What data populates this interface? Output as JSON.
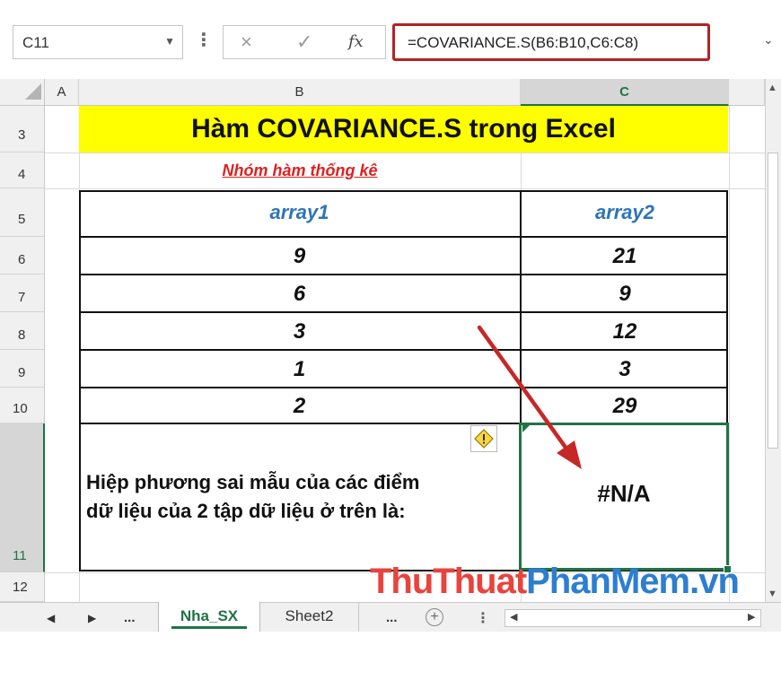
{
  "formula_bar": {
    "name_box": "C11",
    "cancel_icon": "×",
    "enter_icon": "✓",
    "fx_label": "fx",
    "formula": "=COVARIANCE.S(B6:B10,C6:C8)"
  },
  "columns": [
    {
      "label": "A"
    },
    {
      "label": "B"
    },
    {
      "label": "C",
      "selected": true
    }
  ],
  "rows": [
    "3",
    "4",
    "5",
    "6",
    "7",
    "8",
    "9",
    "10",
    "11",
    "12"
  ],
  "sheet": {
    "title": "Hàm COVARIANCE.S trong Excel",
    "subtitle": "Nhóm hàm thống kê",
    "header_array1": "array1",
    "header_array2": "array2",
    "data": [
      {
        "array1": "9",
        "array2": "21"
      },
      {
        "array1": "6",
        "array2": "9"
      },
      {
        "array1": "3",
        "array2": "12"
      },
      {
        "array1": "1",
        "array2": "3"
      },
      {
        "array1": "2",
        "array2": "29"
      }
    ],
    "description_line1": "Hiệp phương sai mẫu của các điểm",
    "description_line2": "dữ liệu của 2 tập dữ liệu ở trên là:",
    "result": "#N/A"
  },
  "watermark": {
    "part1": "ThuThuat",
    "part2": "PhanMem.vn"
  },
  "tabs": {
    "more_left": "...",
    "active_tab": "Nha_SX",
    "tab2": "Sheet2",
    "more_right": "...",
    "add_sheet": "+"
  },
  "colors": {
    "title_fill": "#ffff00",
    "subtitle_text": "#e02020",
    "header_text": "#2e75b6",
    "selection": "#217346",
    "formula_highlight": "#b42323",
    "arrow": "#c62828"
  }
}
